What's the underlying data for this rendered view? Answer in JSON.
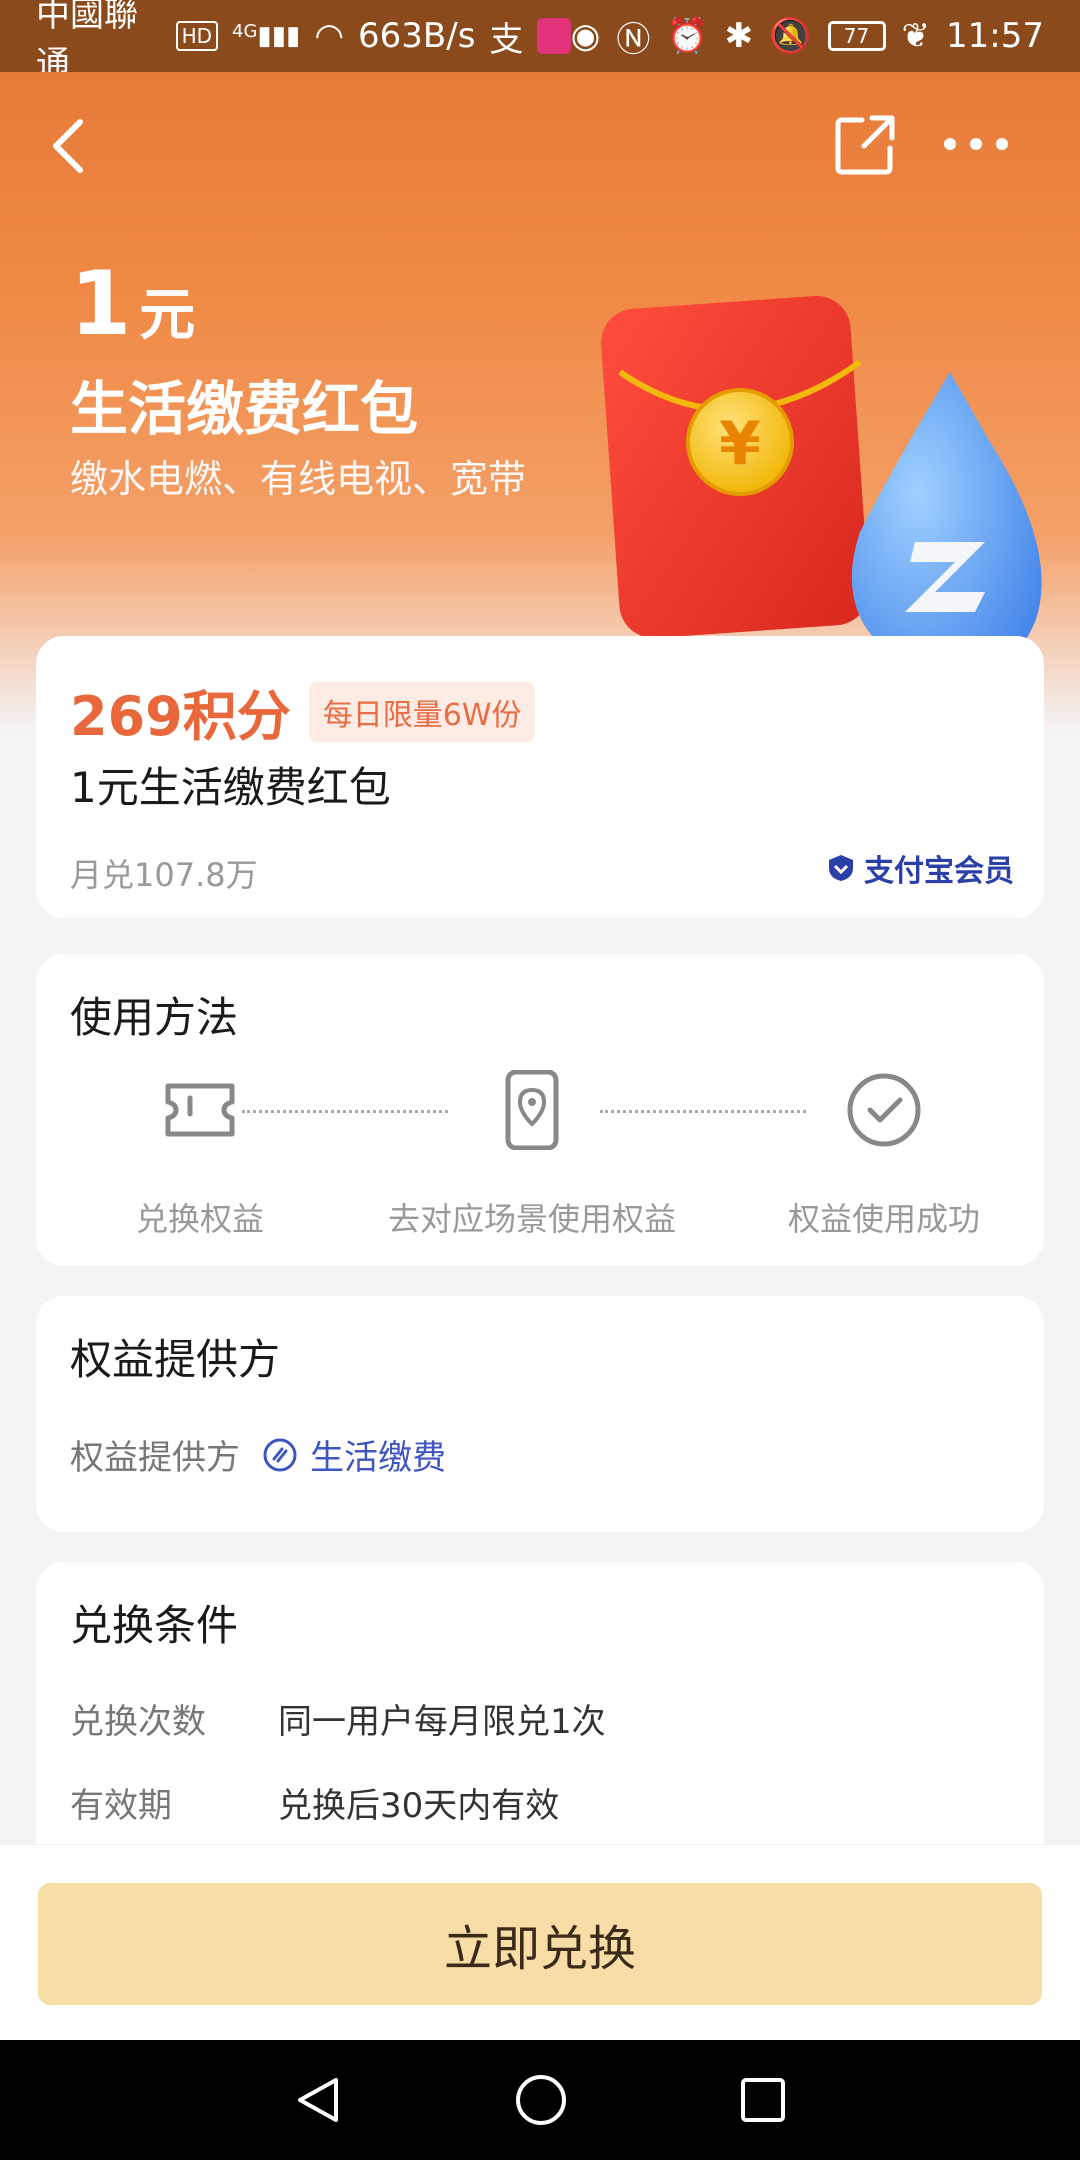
{
  "status_bar": {
    "carrier": "中國聯通",
    "hd": "HD",
    "network": "4G",
    "speed": "663B/s",
    "battery": "77",
    "time": "11:57"
  },
  "hero": {
    "amount": "1",
    "unit": "元",
    "title": "生活缴费红包",
    "subtitle": "缴水电燃、有线电视、宽带"
  },
  "product": {
    "points": "269积分",
    "limit_badge": "每日限量6W份",
    "title": "1元生活缴费红包",
    "monthly": "月兑107.8万",
    "member_badge": "支付宝会员"
  },
  "usage": {
    "heading": "使用方法",
    "steps": [
      {
        "label": "兑换权益",
        "icon": "ticket-icon"
      },
      {
        "label": "去对应场景使用权益",
        "icon": "phone-location-icon"
      },
      {
        "label": "权益使用成功",
        "icon": "check-circle-icon"
      }
    ]
  },
  "provider": {
    "heading": "权益提供方",
    "label": "权益提供方",
    "name": "生活缴费"
  },
  "conditions": {
    "heading": "兑换条件",
    "rows": [
      {
        "label": "兑换次数",
        "value": "同一用户每月限兑1次"
      },
      {
        "label": "有效期",
        "value": "兑换后30天内有效"
      }
    ]
  },
  "cta": {
    "label": "立即兑换"
  },
  "colors": {
    "accent": "#e9683b",
    "link": "#3f55c2",
    "cta_bg": "#f8dea6"
  }
}
